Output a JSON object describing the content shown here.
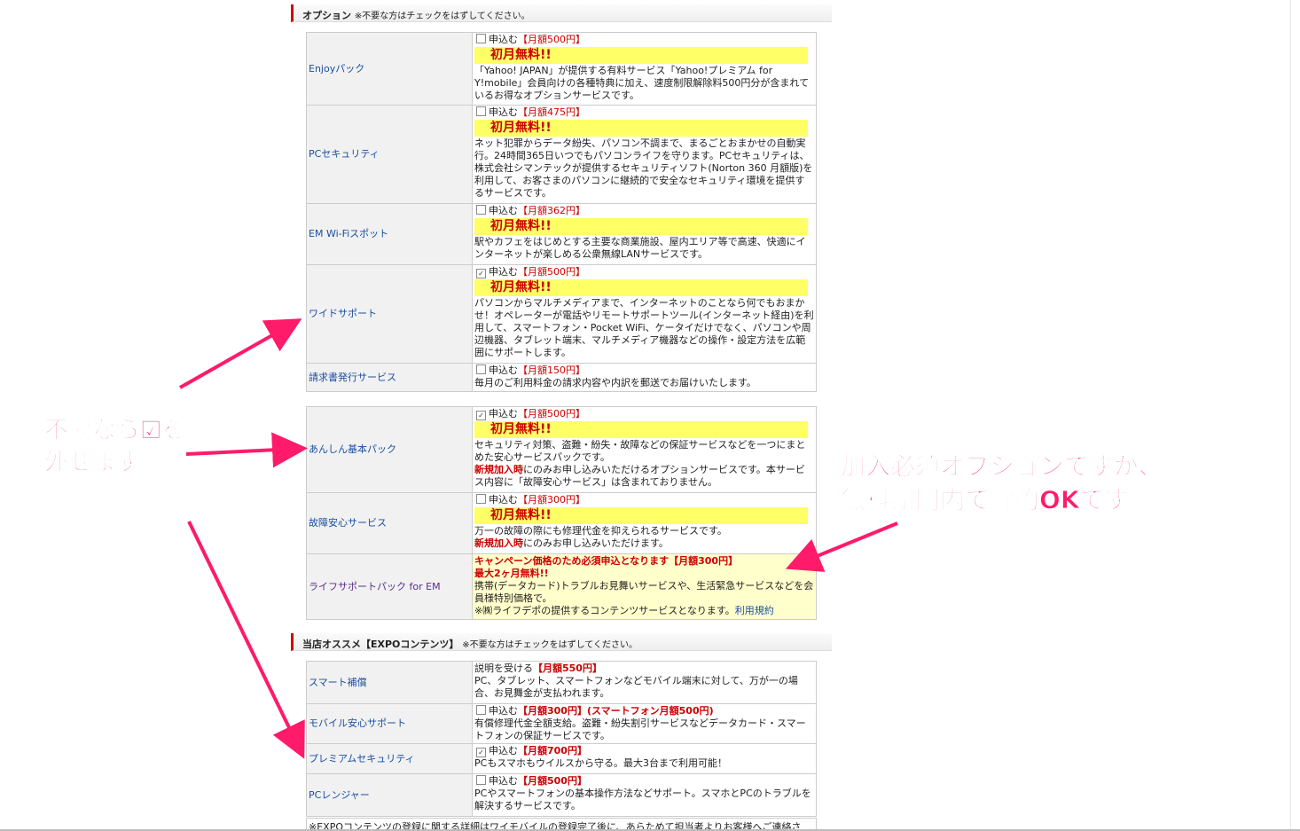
{
  "section_options": {
    "title": "オプション",
    "note": "※不要な方はチェックをはずしてください。"
  },
  "options": [
    {
      "label": "Enjoyパック",
      "checkbox": "申込む",
      "price": "【月額500円】",
      "banner": "初月無料!!",
      "desc": "「Yahoo! JAPAN」が提供する有料サービス「Yahoo!プレミアム for Y!mobile」会員向けの各種特典に加え、速度制限解除料500円分が含まれているお得なオプションサービスです。",
      "checked": false
    },
    {
      "label": "PCセキュリティ",
      "checkbox": "申込む",
      "price": "【月額475円】",
      "banner": "初月無料!!",
      "desc": "ネット犯罪からデータ紛失、パソコン不調まで、まるごとおまかせの自動実行。24時間365日いつでもパソコンライフを守ります。PCセキュリティは、株式会社シマンテックが提供するセキュリティソフト(Norton 360 月額版)を利用して、お客さまのパソコンに継続的で安全なセキュリティ環境を提供するサービスです。",
      "checked": false
    },
    {
      "label": "EM Wi-Fiスポット",
      "checkbox": "申込む",
      "price": "【月額362円】",
      "banner": "初月無料!!",
      "desc": "駅やカフェをはじめとする主要な商業施設、屋内エリア等で高速、快適にインターネットが楽しめる公衆無線LANサービスです。",
      "checked": false
    },
    {
      "label": "ワイドサポート",
      "checkbox": "申込む",
      "price": "【月額500円】",
      "banner": "初月無料!!",
      "desc": "パソコンからマルチメディアまで、インターネットのことなら何でもおまかせ！オペレーターが電話やリモートサポートツール(インターネット経由)を利用して、スマートフォン・Pocket WiFi、ケータイだけでなく、パソコンや周辺機器、タブレット端末、マルチメディア機器などの操作・設定方法を広範囲にサポートします。",
      "checked": true
    },
    {
      "label": "請求書発行サービス",
      "checkbox": "申込む",
      "price": "【月額150円】",
      "desc": "毎月のご利用料金の請求内容や内訳を郵送でお届けいたします。",
      "checked": false
    }
  ],
  "packs": [
    {
      "label": "あんしん基本パック",
      "checkbox": "申込む",
      "price": "【月額500円】",
      "banner": "初月無料!!",
      "desc": "セキュリティ対策、盗難・紛失・故障などの保証サービスなどを一つにまとめた安心サービスパックです。",
      "new_label": "新規加入時",
      "new_desc": "にのみお申し込みいただけるオプションサービスです。本サービス内容に「故障安心サービス」は含まれておりません。",
      "checked": true
    },
    {
      "label": "故障安心サービス",
      "checkbox": "申込む",
      "price": "【月額300円】",
      "banner": "初月無料!!",
      "desc": "万一の故障の際にも修理代金を抑えられるサービスです。",
      "new_label": "新規加入時",
      "new_desc": "にのみお申し込みいただけます。",
      "checked": false
    },
    {
      "label": "ライフサポートパック for EM",
      "campaign": "キャンペーン価格のため必須申込となります【月額300円】",
      "free": "最大2ヶ月無料!!",
      "desc": "携帯(データカード)トラブルお見舞いサービスや、生活緊急サービスなどを会員様特別価格で。",
      "note": "※㈱ライフデポの提供するコンテンツサービスとなります。",
      "link": "利用規約"
    }
  ],
  "section_expo": {
    "title": "当店オススメ【EXPOコンテンツ】",
    "note": "※不要な方はチェックをはずしてください。"
  },
  "expo": [
    {
      "label": "スマート補償",
      "pre": "説明を受ける",
      "price": "【月額550円】",
      "desc": "PC、タブレット、スマートフォンなどモバイル端末に対して、万が一の場合、お見舞金が支払われます。"
    },
    {
      "label": "モバイル安心サポート",
      "checkbox": "申込む",
      "price": "【月額300円】(スマートフォン月額500円)",
      "desc": "有償修理代金全額支給。盗難・紛失割引サービスなどデータカード・スマートフォンの保証サービスです。",
      "checked": false
    },
    {
      "label": "プレミアムセキュリティ",
      "checkbox": "申込む",
      "price": "【月額700円】",
      "desc": "PCもスマホもウイルスから守る。最大3台まで利用可能！",
      "checked": true
    },
    {
      "label": "PCレンジャー",
      "checkbox": "申込む",
      "price": "【月額500円】",
      "desc": "PCやスマートフォンの基本操作方法などサポート。スマホとPCのトラブルを解決するサービスです。",
      "checked": false
    }
  ],
  "footer_note": "※EXPOコンテンツの登録に関する詳細はワイモバイルの登録完了後に、あらためて担当者よりお客様へご連絡さ",
  "annotations": {
    "left_line1": "不要なら☑を",
    "left_line2": "外せます",
    "right_line1": "加入必須オプションですが、",
    "right_line2": "無料期間内で解約OKです。"
  },
  "colors": {
    "annotation": "#ff1a6a",
    "price": "#cc0000",
    "banner": "#ffff66",
    "link": "#1a4fa0"
  }
}
